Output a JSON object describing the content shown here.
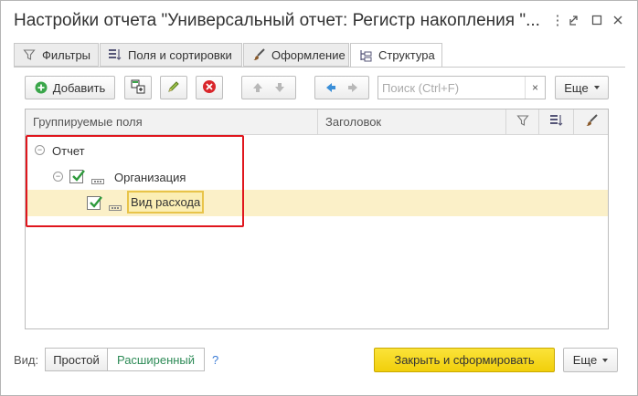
{
  "window": {
    "title": "Настройки отчета \"Универсальный отчет: Регистр накопления \"...",
    "menu_icon": "more-vertical-icon",
    "restore_icon": "link-icon",
    "maximize_icon": "maximize-icon",
    "close_icon": "close-icon"
  },
  "tabs": [
    {
      "label": "Фильтры",
      "icon": "filter-icon",
      "active": false
    },
    {
      "label": "Поля и сортировки",
      "icon": "fields-sort-icon",
      "active": false
    },
    {
      "label": "Оформление",
      "icon": "brush-icon",
      "active": false
    },
    {
      "label": "Структура",
      "icon": "structure-icon",
      "active": true
    }
  ],
  "toolbar": {
    "add_label": "Добавить",
    "search_placeholder": "Поиск (Ctrl+F)",
    "clear_label": "×",
    "more_label": "Еще"
  },
  "grid": {
    "columns": [
      "Группируемые поля",
      "Заголовок"
    ],
    "rows": [
      {
        "label": "Отчет",
        "level": 0,
        "checkbox": false
      },
      {
        "label": "Организация",
        "level": 1,
        "checkbox": true,
        "checked": true
      },
      {
        "label": "Вид расхода",
        "level": 2,
        "checkbox": true,
        "checked": true,
        "selected": true
      }
    ]
  },
  "bottom": {
    "view_label": "Вид:",
    "view_simple": "Простой",
    "view_extended": "Расширенный",
    "help_label": "?",
    "primary_label": "Закрыть и сформировать",
    "more_label": "Еще"
  },
  "colors": {
    "accent_yellow": "#f1cf0b",
    "selection_row": "#fbf0c8",
    "highlight_red": "#e0161d",
    "green_check": "#2e9a3c",
    "extended_text": "#2e8b57"
  }
}
